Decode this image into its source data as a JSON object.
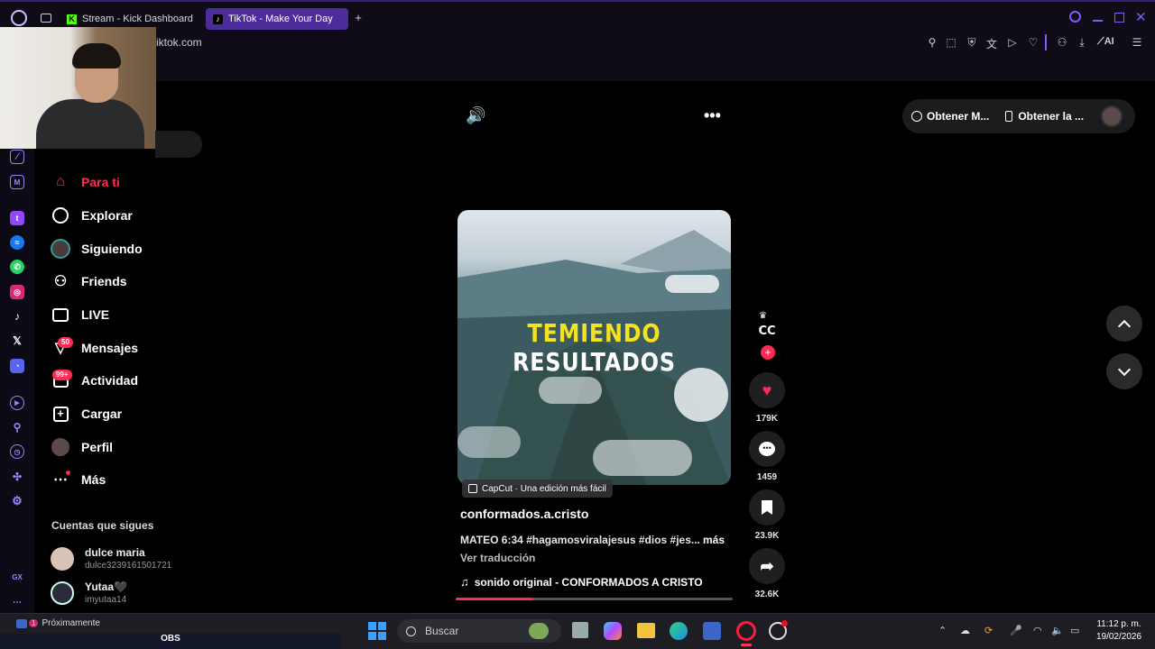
{
  "browser": {
    "tabs": [
      {
        "label": "Stream - Kick Dashboard",
        "icon": "kick-icon"
      },
      {
        "label": "TikTok - Make Your Day",
        "icon": "tiktok-icon"
      }
    ],
    "address": "iktok.com",
    "ai_label": "AI",
    "accent": "#4c2c9a"
  },
  "nav": {
    "items": [
      {
        "label": "Para ti",
        "icon": "home-icon",
        "active": true
      },
      {
        "label": "Explorar",
        "icon": "compass-icon"
      },
      {
        "label": "Siguiendo",
        "icon": "following-avatar-icon"
      },
      {
        "label": "Friends",
        "icon": "friends-icon"
      },
      {
        "label": "LIVE",
        "icon": "live-icon"
      },
      {
        "label": "Mensajes",
        "icon": "messages-icon",
        "badge": "50"
      },
      {
        "label": "Actividad",
        "icon": "activity-icon",
        "badge": "99+"
      },
      {
        "label": "Cargar",
        "icon": "upload-icon"
      },
      {
        "label": "Perfil",
        "icon": "profile-avatar-icon"
      },
      {
        "label": "Más",
        "icon": "more-icon"
      }
    ],
    "following_header": "Cuentas que sigues",
    "accounts": [
      {
        "name": "dulce maria",
        "handle": "dulce3239161501721"
      },
      {
        "name": "Yutaa🖤",
        "handle": "imyutaa14"
      }
    ]
  },
  "video": {
    "overlay_line1": "TEMIENDO",
    "overlay_line2": "RESULTADOS",
    "capcut_label": "CapCut · Una edición más fácil",
    "author": "conformados.a.cristo",
    "description": "MATEO 6:34 #hagamosviralajesus #dios #jes...",
    "more_label": "más",
    "translate_label": "Ver traducción",
    "music": "sonido original - CONFORMADOS A CRISTO",
    "progress": 0.28,
    "accent": "#fe2c55"
  },
  "actions": {
    "creator_badge": "CC",
    "likes": "179K",
    "comments": "1459",
    "saves": "23.9K",
    "shares": "32.6K"
  },
  "top": {
    "get_app_label": "Obtener M...",
    "get_app2_label": "Obtener la ..."
  },
  "taskbar": {
    "upcoming": "Próximamente",
    "upcoming_badge": "1",
    "obs_label": "OBS",
    "search_placeholder": "Buscar",
    "time": "11:12 p. m.",
    "date": "19/02/2026"
  }
}
